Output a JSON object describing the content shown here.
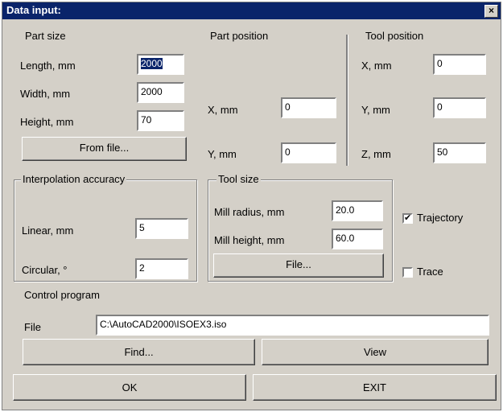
{
  "window": {
    "title": "Data input:",
    "close_label": "×"
  },
  "part_size": {
    "title": "Part size",
    "length_label": "Length, mm",
    "length_value": "2000",
    "width_label": "Width, mm",
    "width_value": "2000",
    "height_label": "Height, mm",
    "height_value": "70",
    "from_file_label": "From file..."
  },
  "part_position": {
    "title": "Part position",
    "x_label": "X, mm",
    "x_value": "0",
    "y_label": "Y, mm",
    "y_value": "0"
  },
  "tool_position": {
    "title": "Tool position",
    "x_label": "X, mm",
    "x_value": "0",
    "y_label": "Y, mm",
    "y_value": "0",
    "z_label": "Z, mm",
    "z_value": "50"
  },
  "interpolation": {
    "title": "Interpolation accuracy",
    "linear_label": "Linear, mm",
    "linear_value": "5",
    "circular_label": "Circular, °",
    "circular_value": "2"
  },
  "tool_size": {
    "title": "Tool size",
    "radius_label": "Mill radius, mm",
    "radius_value": "20.0",
    "height_label": "Mill height, mm",
    "height_value": "60.0",
    "file_label": "File..."
  },
  "options": {
    "trajectory_label": "Trajectory",
    "trajectory_checked": true,
    "trace_label": "Trace",
    "trace_checked": false
  },
  "control_program": {
    "title": "Control program",
    "file_label": "File",
    "file_value": "C:\\AutoCAD2000\\ISOEX3.iso",
    "find_label": "Find...",
    "view_label": "View"
  },
  "footer": {
    "ok_label": "OK",
    "exit_label": "EXIT"
  }
}
